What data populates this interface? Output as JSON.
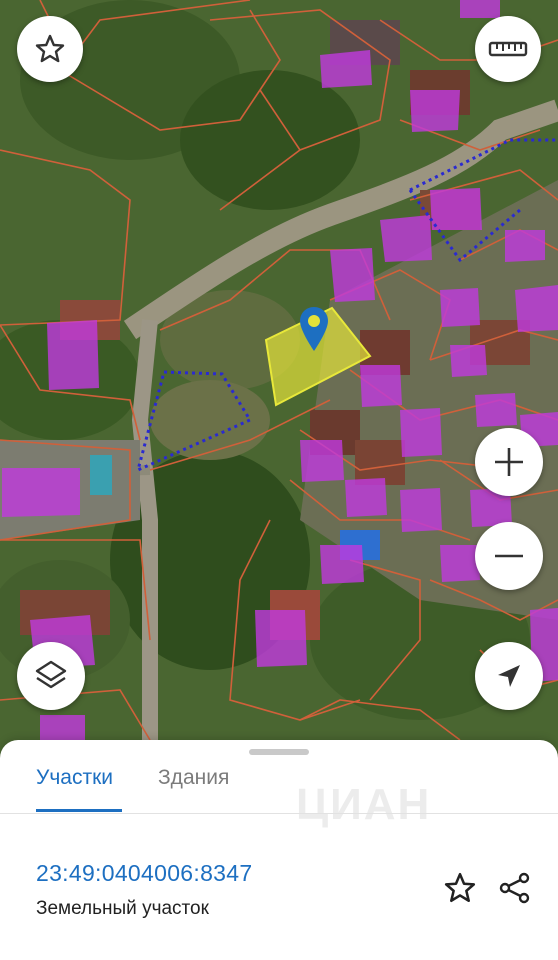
{
  "map": {
    "controls": {
      "favorite_icon": "star-outline-icon",
      "ruler_icon": "ruler-icon",
      "layers_icon": "layers-icon",
      "zoom_in_icon": "plus-icon",
      "zoom_out_icon": "minus-icon",
      "locate_icon": "navigation-arrow-icon"
    },
    "colors": {
      "parcel_outline": "#d0603a",
      "building_fill": "#c13adf",
      "selected_parcel": "#e3e23a",
      "marker": "#1d6fc1",
      "dotted_boundary": "#2a2ad0"
    }
  },
  "sheet": {
    "tabs": [
      "Участки",
      "Здания"
    ],
    "active_tab": "Участки",
    "watermark": "ЦИАН",
    "cadastral_number": "23:49:0404006:8347",
    "object_type": "Земельный участок",
    "favorite_icon": "star-outline-icon",
    "share_icon": "share-icon",
    "accent_color": "#1d6fc1"
  }
}
